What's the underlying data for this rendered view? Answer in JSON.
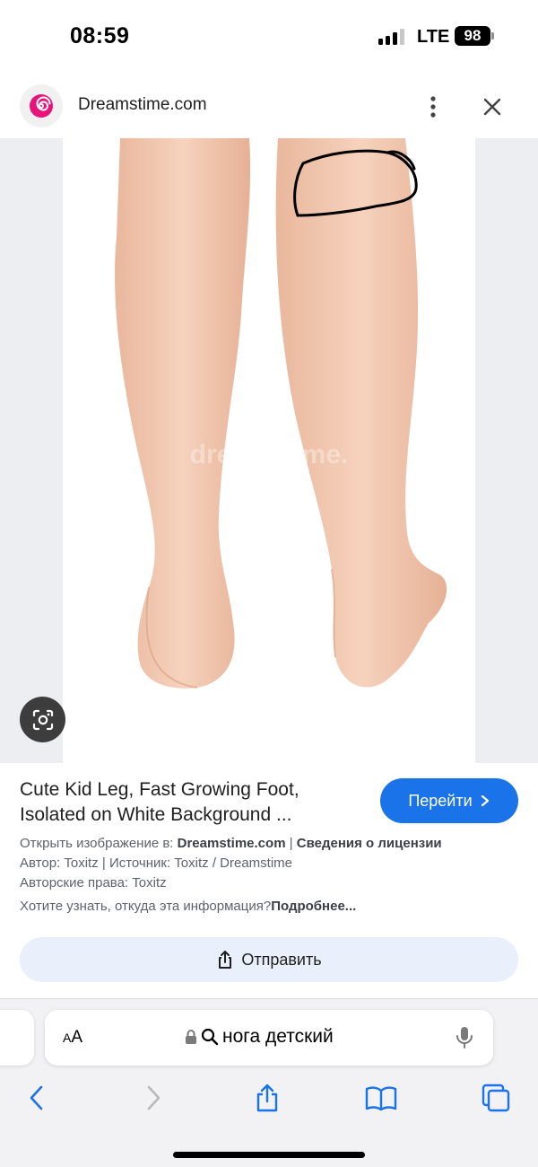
{
  "status_bar": {
    "time": "08:59",
    "network": "LTE",
    "battery": "98"
  },
  "source": {
    "site_name": "Dreamstime.com",
    "logo_icon": "dreamstime-spiral-icon",
    "accent": "#e8147b"
  },
  "image": {
    "watermark": "dreamstime."
  },
  "result": {
    "title": "Cute Kid Leg, Fast Growing Foot, Isolated on White Background ...",
    "visit_label": "Перейти",
    "open_in_label": "Открыть изображение в:",
    "open_in_site": "Dreamstime.com",
    "separator": "|",
    "license_link": "Сведения о лицензии",
    "author_line": "Автор: Toxitz | Источник: Toxitz / Dreamstime",
    "copyright_line": "Авторские права: Toxitz",
    "hint_text": "Хотите узнать, откуда эта информация?",
    "hint_link": "Подробнее...",
    "share_label": "Отправить"
  },
  "browser": {
    "text_size_small": "A",
    "text_size_large": "A",
    "address": "нога детский",
    "nav": [
      "back-icon",
      "forward-icon",
      "share-icon",
      "bookmarks-icon",
      "tabs-icon"
    ]
  },
  "colors": {
    "primary_button": "#1a73e8",
    "share_button_bg": "#e9f0fc",
    "drawn_annotation": "#000000"
  }
}
